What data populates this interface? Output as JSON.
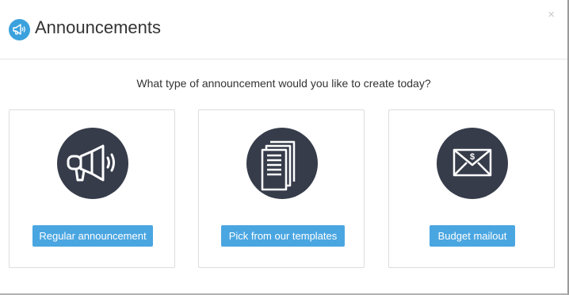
{
  "header": {
    "title": "Announcements",
    "icon": "megaphone-icon",
    "close_symbol": "×"
  },
  "prompt": "What type of announcement would you like to create today?",
  "options": [
    {
      "icon": "megaphone-icon",
      "button_label": "Regular announcement"
    },
    {
      "icon": "documents-icon",
      "button_label": "Pick from our templates"
    },
    {
      "icon": "envelope-dollar-icon",
      "button_label": "Budget mailout"
    }
  ],
  "colors": {
    "accent": "#4aa6e1",
    "header_icon_bg": "#3aa1dd",
    "icon_circle_bg": "#363c4a"
  }
}
